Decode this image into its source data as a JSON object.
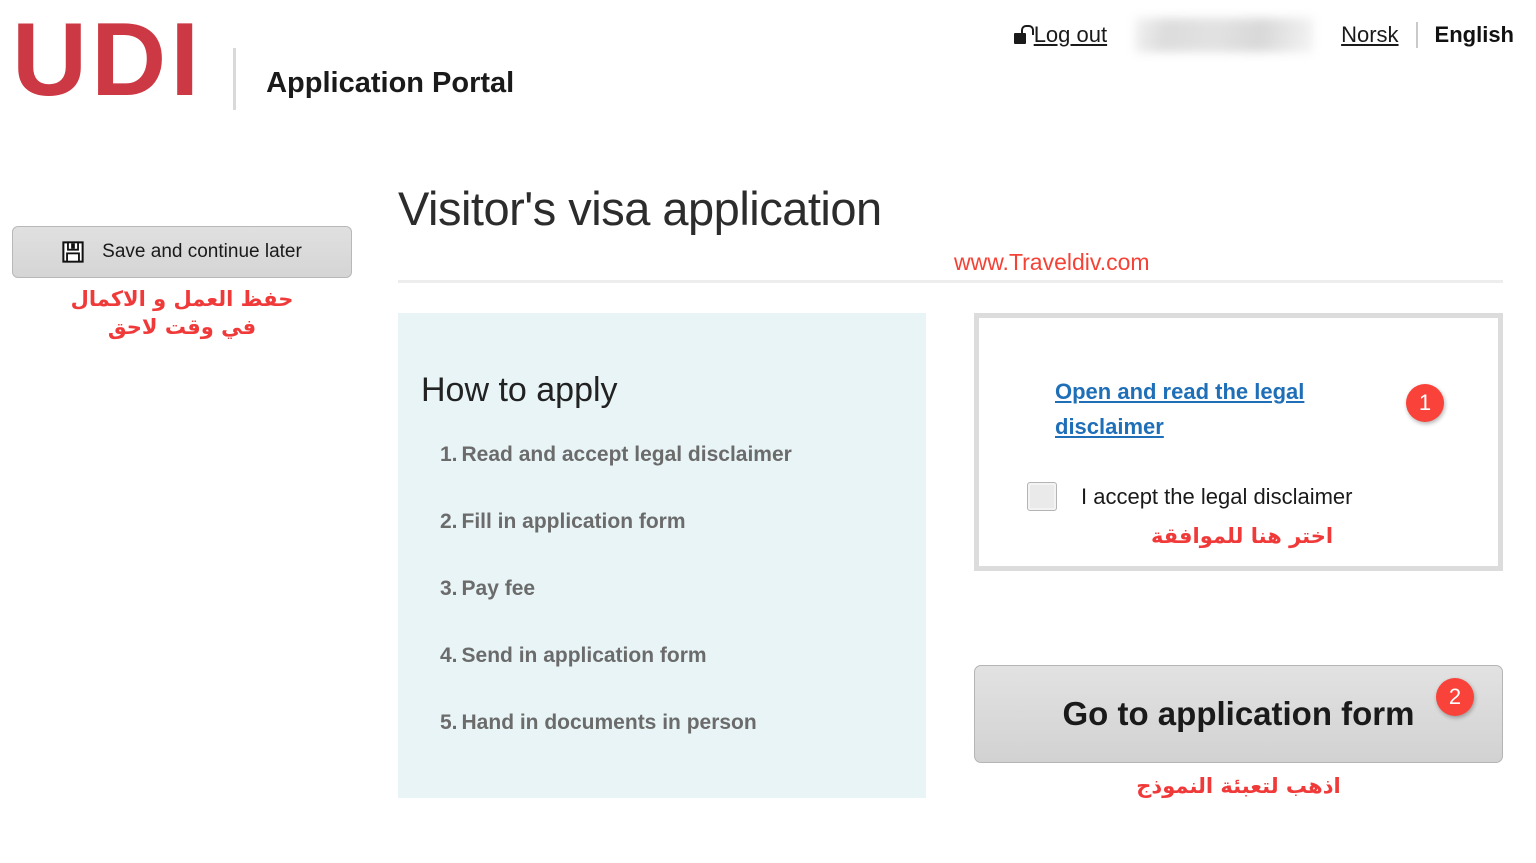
{
  "header": {
    "logo_text": "UDI",
    "portal_name": "Application Portal",
    "logout_label": "Log out",
    "logout_icon": "open-lock-icon",
    "username_redacted": "",
    "lang_norsk": "Norsk",
    "lang_english": "English",
    "brand_red": "#cc3843"
  },
  "sidebar": {
    "save_label": "Save and continue later",
    "save_icon": "floppy-disk-save-icon",
    "save_arabic_line1": "حفظ العمل و الاكمال",
    "save_arabic_line2": "في وقت لاحق"
  },
  "main": {
    "page_title": "Visitor's visa application",
    "watermark": "www.Traveldiv.com",
    "how_to_apply": {
      "heading": "How to apply",
      "steps": [
        {
          "num": "1.",
          "text": "Read and accept legal disclaimer"
        },
        {
          "num": "2.",
          "text": "Fill in application form"
        },
        {
          "num": "3.",
          "text": "Pay fee"
        },
        {
          "num": "4.",
          "text": "Send in application form"
        },
        {
          "num": "5.",
          "text": "Hand in documents in person"
        }
      ],
      "panel_color": "#e8f4f6"
    },
    "disclaimer": {
      "link_text": "Open and read the legal disclaimer",
      "link_color": "#1f6fb8",
      "accept_label": "I accept the legal disclaimer",
      "accept_checked": false,
      "accept_arabic": "اختر هنا للموافقة"
    },
    "goto_form": {
      "label": "Go to application form",
      "arabic": "اذهب لتعبئة النموذج"
    },
    "badges": {
      "one": "1",
      "two": "2",
      "color": "#f9423a"
    }
  }
}
